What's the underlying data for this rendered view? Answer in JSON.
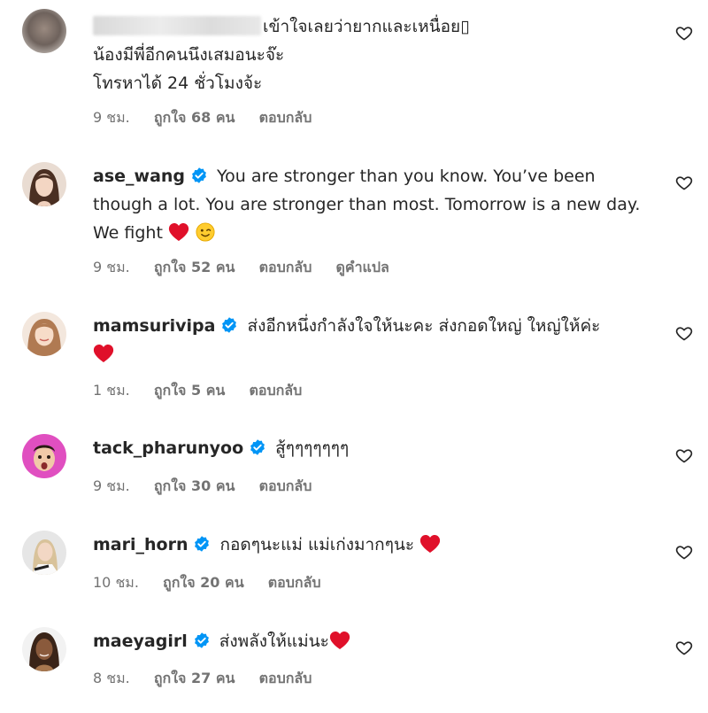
{
  "comments": [
    {
      "username": "",
      "username_blurred": true,
      "verified": false,
      "lines": [
        "เข้าใจเลยว่ายากและเหนื่อย",
        "น้องมีพี่อีกคนนึงเสมอนะจ๊ะ",
        "โทรหาได้ 24 ชั่วโมงจ้ะ"
      ],
      "placeholder_glyph": "▯",
      "time": "9 ชม.",
      "likes": "ถูกใจ 68 คน",
      "reply": "ตอบกลับ"
    },
    {
      "username": "ase_wang",
      "verified": true,
      "text": "You are stronger than you know. You’ve been though a lot. You are stronger than most. Tomorrow is a new day. We fight",
      "emojis": [
        "red-heart",
        "winking-face"
      ],
      "time": "9 ชม.",
      "likes": "ถูกใจ 52 คน",
      "reply": "ตอบกลับ",
      "translate": "ดูคำแปล"
    },
    {
      "username": "mamsurivipa",
      "verified": true,
      "text": "ส่งอีกหนึ่งกำลังใจให้นะคะ ส่งกอดใหญ่ ใหญ่ให้ค่ะ",
      "emojis": [
        "red-heart"
      ],
      "time": "1 ชม.",
      "likes": "ถูกใจ 5 คน",
      "reply": "ตอบกลับ"
    },
    {
      "username": "tack_pharunyoo",
      "verified": true,
      "text": "สู้ๆๆๆๆๆๆๆ",
      "emojis": [],
      "time": "9 ชม.",
      "likes": "ถูกใจ 30 คน",
      "reply": "ตอบกลับ"
    },
    {
      "username": "mari_horn",
      "verified": true,
      "text": "กอดๆนะแม่ แม่เก่งมากๆนะ",
      "emojis": [
        "red-heart"
      ],
      "time": "10 ชม.",
      "likes": "ถูกใจ 20 คน",
      "reply": "ตอบกลับ"
    },
    {
      "username": "maeyagirl",
      "verified": true,
      "text": "ส่งพลังให้แม่นะ",
      "emojis": [
        "red-heart"
      ],
      "time": "8 ชม.",
      "likes": "ถูกใจ 27 คน",
      "reply": "ตอบกลับ"
    }
  ],
  "icons": {
    "verified_color": "#0095f6",
    "heart_color": "#e0102a",
    "like_outline_color": "#262626"
  }
}
